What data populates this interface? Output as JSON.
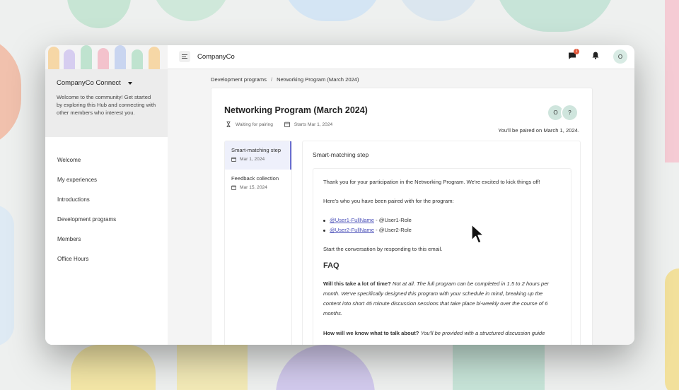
{
  "topbar": {
    "brand": "CompanyCo",
    "notification_count": "1"
  },
  "user": {
    "initial": "O"
  },
  "sidebar": {
    "org_name": "CompanyCo Connect",
    "welcome": "Welcome to the community! Get started by exploring this Hub and connecting with other members who interest you.",
    "items": [
      {
        "label": "Welcome"
      },
      {
        "label": "My experiences"
      },
      {
        "label": "Introductions"
      },
      {
        "label": "Development programs"
      },
      {
        "label": "Members"
      },
      {
        "label": "Office Hours"
      }
    ]
  },
  "breadcrumb": {
    "parent": "Development programs",
    "separator": "/",
    "current": "Networking Program (March 2024)"
  },
  "program": {
    "title": "Networking Program (March 2024)",
    "status": "Waiting for pairing",
    "start": "Starts Mar 1, 2024",
    "pair_avatars": [
      "O",
      "?"
    ],
    "paired_note": "You'll be paired on March 1, 2024."
  },
  "steps": [
    {
      "name": "Smart-matching step",
      "date": "Mar 1, 2024"
    },
    {
      "name": "Feedback collection",
      "date": "Mar 15, 2024"
    }
  ],
  "content": {
    "title": "Smart-matching step",
    "intro": "Thank you for your participation in the Networking Program. We're excited to kick things off!",
    "paired_line": "Here's who you have been paired with for the program:",
    "pairs": [
      {
        "name": "@User1-FullName",
        "role": " - @User1-Role"
      },
      {
        "name": "@User2-FullName",
        "role": " - @User2-Role"
      }
    ],
    "cta": "Start the conversation by responding to this email.",
    "faq_heading": "FAQ",
    "faq": [
      {
        "q": "Will this take a lot of time?",
        "a_italic": "Not at all.",
        "a_rest": " The full program can be completed in 1.5 to 2 hours per month. We've specifically designed this program with your schedule in mind, breaking up the content into short 45 minute discussion sessions that take place bi-weekly over the course of 6 months."
      },
      {
        "q": "How will we know what to talk about?",
        "a_italic": "You'll be provided with a structured discussion guide",
        "a_rest": ""
      }
    ]
  },
  "colors": {
    "accent": "#6a6fd1",
    "badge": "#e0573b",
    "link": "#4a4fb8"
  }
}
